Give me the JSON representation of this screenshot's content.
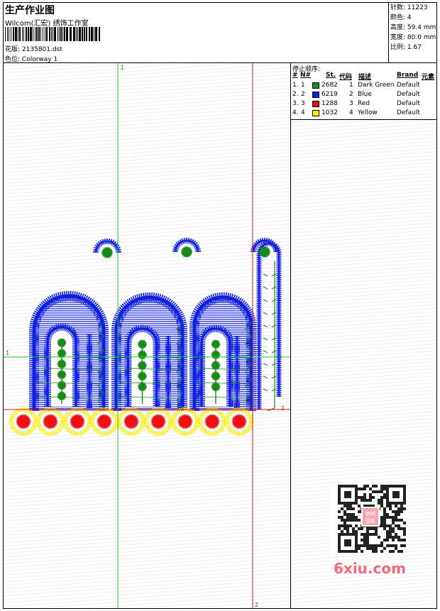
{
  "header": {
    "title": "生产作业图",
    "company": "Wilcom(汇宏) 绣饰工作室",
    "design_label": "花版:",
    "design_file": "2135801.dst",
    "colorway_label": "色位:",
    "colorway": "Colorway 1"
  },
  "stats": [
    {
      "label": "针数:",
      "value": "11223"
    },
    {
      "label": "颜色:",
      "value": "4"
    },
    {
      "label": "高度:",
      "value": "59.4 mm"
    },
    {
      "label": "宽度:",
      "value": "80.0 mm"
    },
    {
      "label": "比例:",
      "value": "1.67"
    }
  ],
  "legend": {
    "title": "停止顺序:",
    "headers": {
      "num": "#",
      "n": "N#",
      "st": "St.",
      "code": "代码",
      "desc": "描述",
      "brand": "Brand",
      "elem": "元素"
    },
    "rows": [
      {
        "num": "1.",
        "n": "1",
        "color": "#1a8a1a",
        "st": "2682",
        "code": "1",
        "desc": "Dark Green",
        "brand": "Default"
      },
      {
        "num": "2.",
        "n": "2",
        "color": "#1020e0",
        "st": "6219",
        "code": "2",
        "desc": "Blue",
        "brand": "Default"
      },
      {
        "num": "3.",
        "n": "3",
        "color": "#ee1010",
        "st": "1288",
        "code": "3",
        "desc": "Red",
        "brand": "Default"
      },
      {
        "num": "4.",
        "n": "4",
        "color": "#ffee00",
        "st": "1032",
        "code": "4",
        "desc": "Yellow",
        "brand": "Default"
      }
    ]
  },
  "guides": {
    "green_label": "1",
    "red_label": "2"
  },
  "colors": {
    "green": "#1a8a1a",
    "blue": "#1020e0",
    "red": "#ee1010",
    "yellow": "#ffee00",
    "guide_green": "#22cc22",
    "guide_red": "#dd1111"
  },
  "qr_icon": "qr-code-icon",
  "qr_badge": "刺绣图库",
  "watermark": "6xiu.com"
}
